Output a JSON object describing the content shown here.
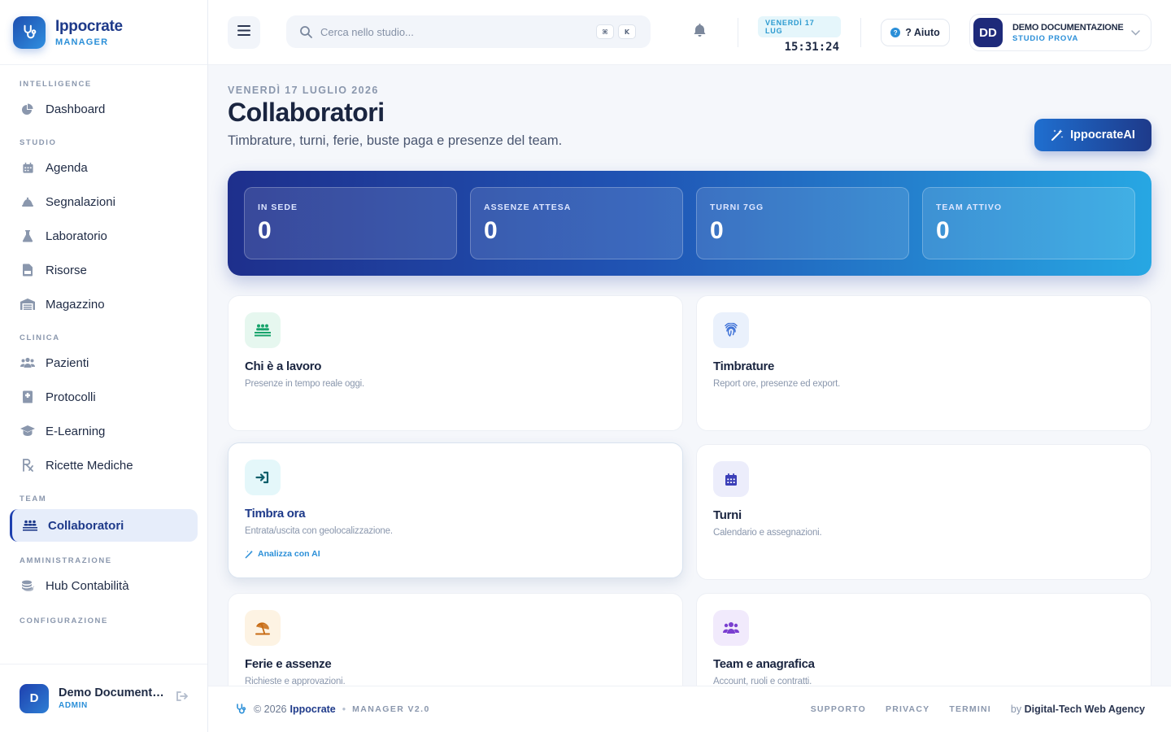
{
  "brand": {
    "name": "Ippocrate",
    "sub": "MANAGER"
  },
  "sidebar": {
    "sections": [
      {
        "title": "INTELLIGENCE",
        "items": [
          {
            "label": "Dashboard",
            "icon": "pie-chart-icon"
          }
        ]
      },
      {
        "title": "STUDIO",
        "items": [
          {
            "label": "Agenda",
            "icon": "calendar-icon"
          },
          {
            "label": "Segnalazioni",
            "icon": "bell-icon"
          },
          {
            "label": "Laboratorio",
            "icon": "flask-icon"
          },
          {
            "label": "Risorse",
            "icon": "document-icon"
          },
          {
            "label": "Magazzino",
            "icon": "warehouse-icon"
          }
        ]
      },
      {
        "title": "CLINICA",
        "items": [
          {
            "label": "Pazienti",
            "icon": "users-icon"
          },
          {
            "label": "Protocolli",
            "icon": "book-icon"
          },
          {
            "label": "E-Learning",
            "icon": "graduation-cap-icon"
          },
          {
            "label": "Ricette Mediche",
            "icon": "prescription-icon"
          }
        ]
      },
      {
        "title": "TEAM",
        "items": [
          {
            "label": "Collaboratori",
            "icon": "team-icon",
            "active": true
          }
        ]
      },
      {
        "title": "AMMINISTRAZIONE",
        "items": [
          {
            "label": "Hub Contabilità",
            "icon": "coins-icon"
          }
        ]
      },
      {
        "title": "CONFIGURAZIONE",
        "items": []
      }
    ],
    "user": {
      "initial": "D",
      "name": "Demo Documentazione",
      "role": "ADMIN"
    }
  },
  "topbar": {
    "search_placeholder": "Cerca nello studio...",
    "kbd": [
      "⌘",
      "K"
    ],
    "date_pill": "VENERDÌ 17 LUG",
    "time": "15:31:24",
    "help_label": "? Aiuto",
    "account": {
      "initials": "DD",
      "name": "DEMO DOCUMENTAZIONE",
      "sub": "STUDIO PROVA"
    }
  },
  "page": {
    "date": "VENERDÌ 17 LUGLIO 2026",
    "title": "Collaboratori",
    "subtitle": "Timbrature, turni, ferie, buste paga e presenze del team.",
    "ai_button": "IppocrateAI"
  },
  "stats": [
    {
      "label": "IN SEDE",
      "value": "0"
    },
    {
      "label": "ASSENZE ATTESA",
      "value": "0"
    },
    {
      "label": "TURNI 7GG",
      "value": "0"
    },
    {
      "label": "TEAM ATTIVO",
      "value": "0"
    }
  ],
  "cards": [
    {
      "title": "Chi è a lavoro",
      "desc": "Presenze in tempo reale oggi.",
      "icon": "people-working-icon",
      "color": "#16a36b",
      "bg": "#e6f7ef"
    },
    {
      "title": "Timbrature",
      "desc": "Report ore, presenze ed export.",
      "icon": "fingerprint-icon",
      "color": "#3b6fd6",
      "bg": "#eaf1fc"
    },
    {
      "title": "Timbra ora",
      "desc": "Entrata/uscita con geolocalizzazione.",
      "icon": "sign-in-icon",
      "color": "#0e5f6b",
      "bg": "#e4f7fa",
      "ai": "Analizza con AI"
    },
    {
      "title": "Turni",
      "desc": "Calendario e assegnazioni.",
      "icon": "calendar-grid-icon",
      "color": "#3b3fb8",
      "bg": "#ecedfb"
    },
    {
      "title": "Ferie e assenze",
      "desc": "Richieste e approvazioni.",
      "icon": "beach-umbrella-icon",
      "color": "#c76a12",
      "bg": "#fdf3e3"
    },
    {
      "title": "Team e anagrafica",
      "desc": "Account, ruoli e contratti.",
      "icon": "users-group-icon",
      "color": "#7a3fd0",
      "bg": "#f1eafc"
    }
  ],
  "footer": {
    "copyright": "© 2026",
    "brand": "Ippocrate",
    "version": "MANAGER V2.0",
    "links": [
      "SUPPORTO",
      "PRIVACY",
      "TERMINI"
    ],
    "by_prefix": "by",
    "by_name": "Digital-Tech Web Agency"
  }
}
